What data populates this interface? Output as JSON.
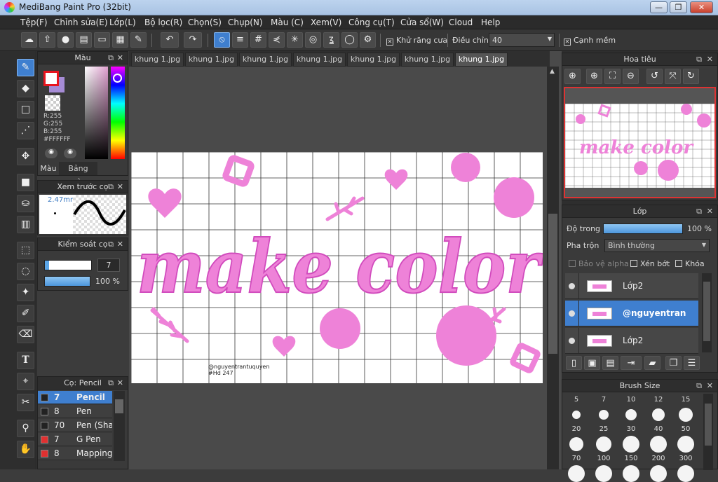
{
  "window": {
    "title": "MediBang Paint Pro (32bit)",
    "minimize": "—",
    "restore": "❐",
    "close": "✕"
  },
  "menu": [
    "Tệp(F)",
    "Chỉnh sửa(E)",
    "Lớp(L)",
    "Bộ lọc(R)",
    "Chọn(S)",
    "Chụp(N)",
    "Màu (C)",
    "Xem(V)",
    "Công cụ(T)",
    "Cửa sổ(W)",
    "Cloud",
    "Help"
  ],
  "toolbar": {
    "antialias_label": "Khử răng cưa",
    "adjust_label": "Điều chỉnh",
    "adjust_value": "40",
    "edge_label": "Cạnh mềm"
  },
  "color_panel": {
    "title": "Màu",
    "rgb": [
      "R:255",
      "G:255",
      "B:255"
    ],
    "hex": "#FFFFFF",
    "tab_color": "Màu",
    "tab_palette": "Bảng màu",
    "fg_color": "#e8141e",
    "bg_color": "#ffffff"
  },
  "brush_preview": {
    "title": "Xem trước cọ",
    "size": "2.47mm"
  },
  "brush_control": {
    "title": "Kiểm soát cọ",
    "size_value": "7",
    "opacity_value": "100 %"
  },
  "brush_list": {
    "title": "Cọ: Pencil",
    "items": [
      {
        "size": "7",
        "name": "Pencil",
        "color": "#222222",
        "selected": true
      },
      {
        "size": "8",
        "name": "Pen",
        "color": "#222222",
        "selected": false
      },
      {
        "size": "70",
        "name": "Pen (Sha",
        "color": "#222222",
        "selected": false
      },
      {
        "size": "7",
        "name": "G Pen",
        "color": "#e03030",
        "selected": false
      },
      {
        "size": "8",
        "name": "Mapping",
        "color": "#e03030",
        "selected": false
      }
    ]
  },
  "tabs": [
    "khung 1.jpg",
    "khung 1.jpg",
    "khung 1.jpg",
    "khung 1.jpg",
    "khung 1.jpg",
    "khung 1.jpg",
    "khung 1.jpg"
  ],
  "artwork": {
    "main_text": "make color",
    "credit_line1": "@nguyentrantuquyen",
    "credit_line2": "#Hd 247",
    "accent": "#ee82d8"
  },
  "navigator": {
    "title": "Hoa tiêu",
    "preview_text": "make color"
  },
  "layers": {
    "title": "Lớp",
    "opacity_label": "Độ trong",
    "opacity_value": "100 %",
    "opacity_fraction": 1.0,
    "blend_label": "Pha trộn",
    "blend_value": "Bình thường",
    "protect_alpha": "Bảo vệ alpha",
    "clipping": "Xén bớt",
    "lock": "Khóa",
    "items": [
      {
        "name": "Lớp2",
        "selected": false
      },
      {
        "name": "@nguyentran",
        "selected": true
      },
      {
        "name": "Lớp2",
        "selected": false
      }
    ]
  },
  "brush_size": {
    "title": "Brush Size",
    "row1": [
      "5",
      "7",
      "10",
      "12",
      "15"
    ],
    "row2": [
      "20",
      "25",
      "30",
      "40",
      "50"
    ],
    "row3": [
      "70",
      "100",
      "150",
      "200",
      "300"
    ]
  }
}
